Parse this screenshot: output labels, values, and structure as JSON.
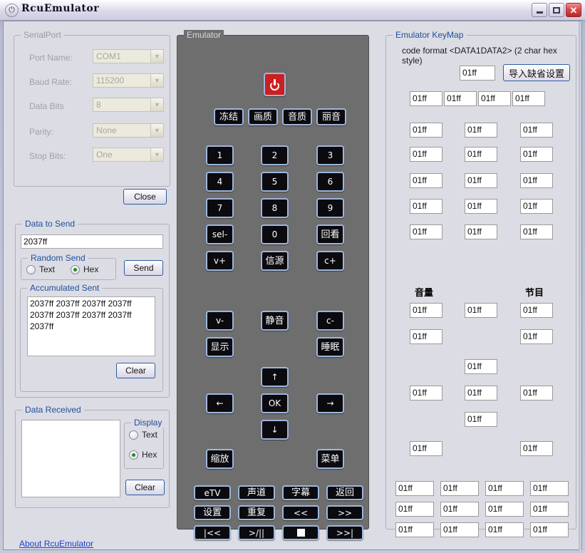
{
  "window": {
    "title": "RcuEmulator",
    "icon": "power-icon",
    "minimize_label": "Minimize",
    "maximize_label": "Maximize",
    "close_label": "Close"
  },
  "serial_port": {
    "group_label": "SerialPort",
    "fields": [
      {
        "label": "Port Name:",
        "value": "COM1"
      },
      {
        "label": "Baud Rate:",
        "value": "115200"
      },
      {
        "label": "Data Bits",
        "value": "8"
      },
      {
        "label": "Parity:",
        "value": "None"
      },
      {
        "label": "Stop Bits:",
        "value": "One"
      }
    ],
    "close_button": "Close"
  },
  "data_to_send": {
    "group_label": "Data to Send",
    "input_value": "2037ff",
    "random_send": {
      "group_label": "Random Send",
      "text_label": "Text",
      "hex_label": "Hex",
      "selected": "Hex"
    },
    "send_button": "Send",
    "accumulated": {
      "group_label": "Accumulated Sent",
      "content": "2037ff 2037ff 2037ff 2037ff 2037ff 2037ff 2037ff 2037ff 2037ff"
    },
    "clear_button": "Clear"
  },
  "data_received": {
    "group_label": "Data Received",
    "content": "",
    "display": {
      "group_label": "Display",
      "text_label": "Text",
      "hex_label": "Hex",
      "selected": "Hex"
    },
    "clear_button": "Clear"
  },
  "about_link": "About RcuEmulator",
  "emulator": {
    "group_label": "Emulator",
    "power_button": "power-button",
    "function_row": [
      "冻结",
      "画质",
      "音质",
      "丽音"
    ],
    "numpad": [
      [
        "1",
        "2",
        "3"
      ],
      [
        "4",
        "5",
        "6"
      ],
      [
        "7",
        "8",
        "9"
      ],
      [
        "sel-",
        "0",
        "回看"
      ],
      [
        "v+",
        "信源",
        "c+"
      ]
    ],
    "mid_row1": [
      "v-",
      "静音",
      "c-"
    ],
    "mid_row2": [
      "显示",
      "睡眠"
    ],
    "dpad": {
      "up": "↑",
      "left": "←",
      "ok": "OK",
      "right": "→",
      "down": "↓"
    },
    "zoom_button": "缩放",
    "menu_button": "菜单",
    "media_rows": [
      [
        "eTV",
        "声道",
        "字幕",
        "返回"
      ],
      [
        "设置",
        "重复",
        "<<",
        ">>"
      ],
      [
        "|<<",
        ">/||",
        "■",
        ">>|"
      ]
    ]
  },
  "keymap": {
    "group_label": "Emulator KeyMap",
    "format_note": "code format <DATA1DATA2> (2 char hex style)",
    "import_button": "导入缺省设置",
    "default_code": "01ff",
    "group_labels": {
      "volume": "音量",
      "program": "节目"
    },
    "power_field": "01ff",
    "function_fields": [
      "01ff",
      "01ff",
      "01ff",
      "01ff"
    ],
    "numpad_fields": [
      [
        "01ff",
        "01ff",
        "01ff"
      ],
      [
        "01ff",
        "01ff",
        "01ff"
      ],
      [
        "01ff",
        "01ff",
        "01ff"
      ],
      [
        "01ff",
        "01ff",
        "01ff"
      ],
      [
        "01ff",
        "01ff",
        "01ff"
      ]
    ],
    "mid_row1_fields": [
      "01ff",
      "01ff",
      "01ff"
    ],
    "mid_row2_fields": [
      "01ff",
      "01ff"
    ],
    "dpad_fields": {
      "up": "01ff",
      "left": "01ff",
      "ok": "01ff",
      "right": "01ff",
      "down": "01ff"
    },
    "zoom_field": "01ff",
    "menu_field": "01ff",
    "media_fields": [
      [
        "01ff",
        "01ff",
        "01ff",
        "01ff"
      ],
      [
        "01ff",
        "01ff",
        "01ff",
        "01ff"
      ],
      [
        "01ff",
        "01ff",
        "01ff",
        "01ff"
      ]
    ]
  },
  "colors": {
    "accent": "#20509a",
    "remote_bg": "#6e6e6e",
    "power_red": "#cc1f1f",
    "link": "#1b3fcf",
    "window_bg": "#dcdce4"
  }
}
